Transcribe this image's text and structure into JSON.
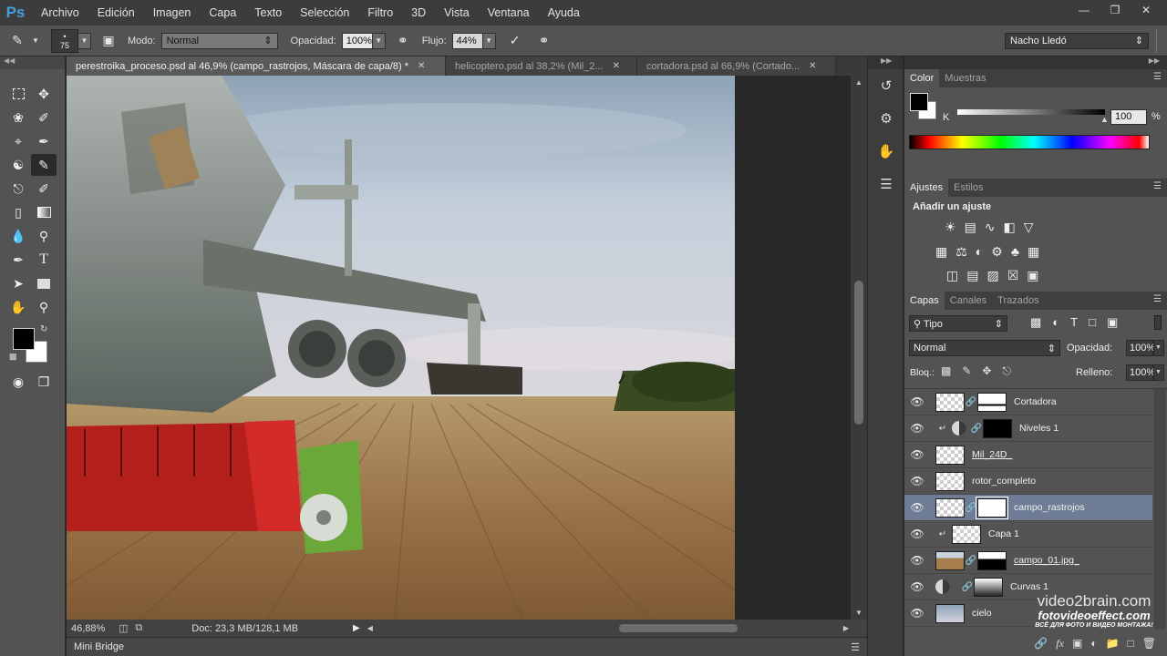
{
  "app": {
    "logo": "Ps",
    "window_controls": [
      "minimize-icon",
      "restore-icon",
      "close-icon"
    ]
  },
  "menu": [
    "Archivo",
    "Edición",
    "Imagen",
    "Capa",
    "Texto",
    "Selección",
    "Filtro",
    "3D",
    "Vista",
    "Ventana",
    "Ayuda"
  ],
  "options": {
    "brush_size": "75",
    "mode_label": "Modo:",
    "mode_value": "Normal",
    "opacity_label": "Opacidad:",
    "opacity_value": "100%",
    "flow_label": "Flujo:",
    "flow_value": "44%",
    "workspace": "Nacho Lledó"
  },
  "tabs": [
    {
      "title": "perestroika_proceso.psd al 46,9% (campo_rastrojos, Máscara de capa/8) *",
      "active": true
    },
    {
      "title": "helicoptero.psd al 38,2% (Mil_2...",
      "active": false
    },
    {
      "title": "cortadora.psd al 66,9% (Cortado...",
      "active": false
    }
  ],
  "status": {
    "zoom": "46,88%",
    "doc_info": "Doc: 23,3 MB/128,1 MB"
  },
  "minibridge": "Mini Bridge",
  "color_panel": {
    "tabs": [
      "Color",
      "Muestras"
    ],
    "channel_label": "K",
    "channel_value": "100",
    "foreground": "#000000",
    "background": "#ffffff"
  },
  "adjustments_panel": {
    "tabs": [
      "Ajustes",
      "Estilos"
    ],
    "heading": "Añadir un ajuste"
  },
  "layers_panel": {
    "tabs": [
      "Capas",
      "Canales",
      "Trazados"
    ],
    "filter_kind": "Tipo",
    "blend_mode": "Normal",
    "opacity_label": "Opacidad:",
    "opacity_value": "100%",
    "lock_label": "Bloq.:",
    "fill_label": "Relleno:",
    "fill_value": "100%",
    "layers": [
      {
        "name": "Cortadora",
        "kind": "pixel-mask",
        "selected": false
      },
      {
        "name": "Niveles 1",
        "kind": "adjustment",
        "selected": false
      },
      {
        "name": "Mil_24D_",
        "kind": "smart",
        "selected": false
      },
      {
        "name": "rotor_completo",
        "kind": "smart",
        "selected": false
      },
      {
        "name": "campo_rastrojos",
        "kind": "smart-mask",
        "selected": true
      },
      {
        "name": "Capa 1",
        "kind": "pixel",
        "selected": false
      },
      {
        "name": "campo_01.jpg_",
        "kind": "image-mask",
        "selected": false
      },
      {
        "name": "Curvas 1",
        "kind": "adjustment",
        "selected": false
      },
      {
        "name": "cielo",
        "kind": "smart",
        "selected": false
      }
    ]
  },
  "watermark": {
    "brand": "video2brain.com",
    "site": "fotovideoeffect.com",
    "tagline": "ВСЁ ДЛЯ ФОТО И ВИДЕО МОНТАЖА!"
  }
}
